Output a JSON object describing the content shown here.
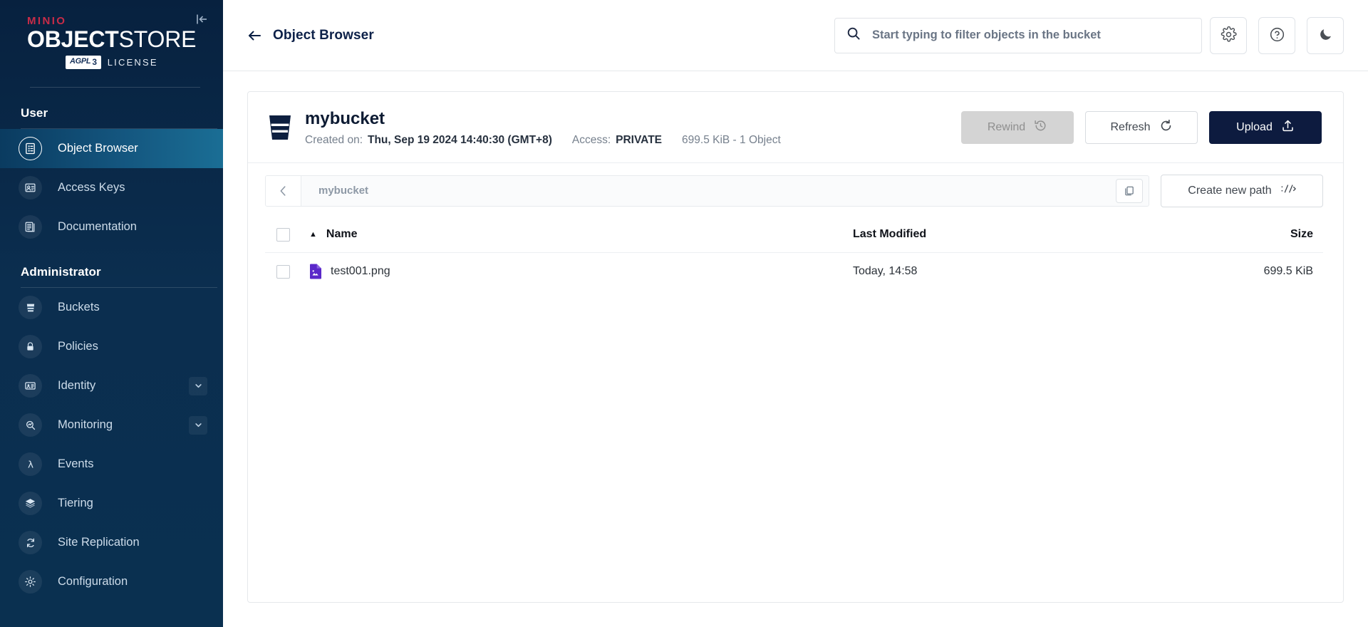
{
  "brand": {
    "product_top": "MINIO",
    "product_main_bold": "OBJECT",
    "product_main_light": "STORE",
    "license_badge": "AGPL",
    "license_badge_version": "3",
    "license_text": "LICENSE",
    "accent_red": "#c72c48",
    "sidebar_dark": "#07213f",
    "active_blue": "#14567f"
  },
  "sidebar": {
    "collapse_icon": "collapse-left-icon",
    "sections": [
      {
        "title": "User",
        "items": [
          {
            "label": "Object Browser",
            "icon": "object-browser-icon",
            "active": true,
            "expandable": false
          },
          {
            "label": "Access Keys",
            "icon": "access-keys-icon",
            "active": false,
            "expandable": false
          },
          {
            "label": "Documentation",
            "icon": "documentation-icon",
            "active": false,
            "expandable": false
          }
        ]
      },
      {
        "title": "Administrator",
        "items": [
          {
            "label": "Buckets",
            "icon": "bucket-icon",
            "active": false,
            "expandable": false
          },
          {
            "label": "Policies",
            "icon": "lock-icon",
            "active": false,
            "expandable": false
          },
          {
            "label": "Identity",
            "icon": "identity-card-icon",
            "active": false,
            "expandable": true
          },
          {
            "label": "Monitoring",
            "icon": "monitoring-icon",
            "active": false,
            "expandable": true
          },
          {
            "label": "Events",
            "icon": "lambda-icon",
            "active": false,
            "expandable": false
          },
          {
            "label": "Tiering",
            "icon": "layers-icon",
            "active": false,
            "expandable": false
          },
          {
            "label": "Site Replication",
            "icon": "replication-icon",
            "active": false,
            "expandable": false
          },
          {
            "label": "Configuration",
            "icon": "gear-icon",
            "active": false,
            "expandable": false
          }
        ]
      }
    ]
  },
  "topbar": {
    "back_icon": "arrow-left-icon",
    "title": "Object Browser",
    "search_placeholder": "Start typing to filter objects in the bucket",
    "search_value": "",
    "search_icon": "search-icon",
    "actions": [
      {
        "name": "settings-button",
        "icon": "gear-icon"
      },
      {
        "name": "help-button",
        "icon": "help-circle-icon"
      },
      {
        "name": "theme-button",
        "icon": "moon-icon"
      }
    ]
  },
  "bucket": {
    "icon": "bucket-icon",
    "name": "mybucket",
    "created_label": "Created on:",
    "created_value": "Thu, Sep 19 2024 14:40:30 (GMT+8)",
    "access_label": "Access:",
    "access_value": "PRIVATE",
    "summary": "699.5 KiB - 1 Object",
    "actions": {
      "rewind_label": "Rewind",
      "rewind_icon": "rewind-clock-icon",
      "rewind_disabled": true,
      "refresh_label": "Refresh",
      "refresh_icon": "refresh-icon",
      "upload_label": "Upload",
      "upload_icon": "upload-icon"
    }
  },
  "path_bar": {
    "back_icon": "chevron-left-icon",
    "crumb": "mybucket",
    "copy_icon": "copy-icon",
    "create_path_label": "Create new path",
    "create_path_icon": "new-path-icon"
  },
  "object_table": {
    "columns": [
      {
        "key": "name",
        "label": "Name",
        "sorted": true,
        "sort_dir": "asc"
      },
      {
        "key": "modified",
        "label": "Last Modified"
      },
      {
        "key": "size",
        "label": "Size"
      }
    ],
    "rows": [
      {
        "name": "test001.png",
        "modified": "Today, 14:58",
        "size": "699.5 KiB",
        "file_icon": "image-file-icon",
        "file_icon_color": "#5b28c9",
        "selected": false
      }
    ]
  }
}
